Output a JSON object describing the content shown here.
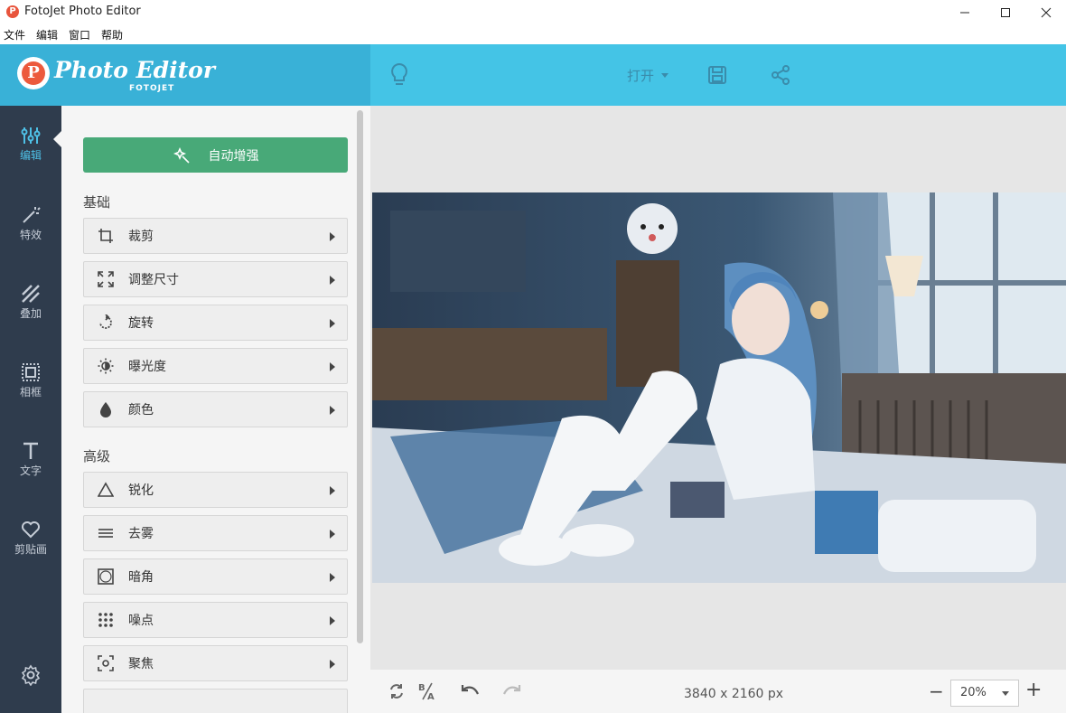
{
  "window": {
    "title": "FotoJet Photo Editor",
    "icon": "fotojet-app-icon"
  },
  "menu": [
    "文件",
    "编辑",
    "窗口",
    "帮助"
  ],
  "brand": {
    "logo_text": "Photo Editor",
    "logo_sub": "FOTOJET",
    "logo_letter": "P"
  },
  "topbar": {
    "open_label": "打开",
    "icons": [
      "lightbulb-icon",
      "save-icon",
      "share-icon"
    ]
  },
  "nav": {
    "items": [
      {
        "label": "编辑",
        "icon": "sliders-icon",
        "active": true
      },
      {
        "label": "特效",
        "icon": "magic-wand-icon",
        "active": false
      },
      {
        "label": "叠加",
        "icon": "overlay-icon",
        "active": false
      },
      {
        "label": "相框",
        "icon": "frame-icon",
        "active": false
      },
      {
        "label": "文字",
        "icon": "text-icon",
        "active": false
      },
      {
        "label": "剪贴画",
        "icon": "heart-icon",
        "active": false
      }
    ],
    "settings_icon": "gear-icon"
  },
  "panel": {
    "auto_enhance": "自动增强",
    "basic_title": "基础",
    "basic_tools": [
      {
        "label": "裁剪",
        "icon": "crop-icon"
      },
      {
        "label": "调整尺寸",
        "icon": "resize-icon"
      },
      {
        "label": "旋转",
        "icon": "rotate-icon"
      },
      {
        "label": "曝光度",
        "icon": "exposure-icon"
      },
      {
        "label": "颜色",
        "icon": "color-drop-icon"
      }
    ],
    "advanced_title": "高级",
    "advanced_tools": [
      {
        "label": "锐化",
        "icon": "sharpen-icon"
      },
      {
        "label": "去雾",
        "icon": "dehaze-icon"
      },
      {
        "label": "暗角",
        "icon": "vignette-icon"
      },
      {
        "label": "噪点",
        "icon": "noise-icon"
      },
      {
        "label": "聚焦",
        "icon": "focus-icon"
      }
    ]
  },
  "bottombar": {
    "dimensions": "3840 x 2160 px",
    "zoom": "20%",
    "icons": [
      "swap-icon",
      "compare-icon",
      "undo-icon",
      "redo-icon"
    ]
  },
  "colors": {
    "brand": "#39b1d7",
    "topbar": "#44c4e6",
    "nav_bg": "#2f3c4d",
    "accent_green": "#48a978",
    "logo_red": "#ec5a3d"
  }
}
